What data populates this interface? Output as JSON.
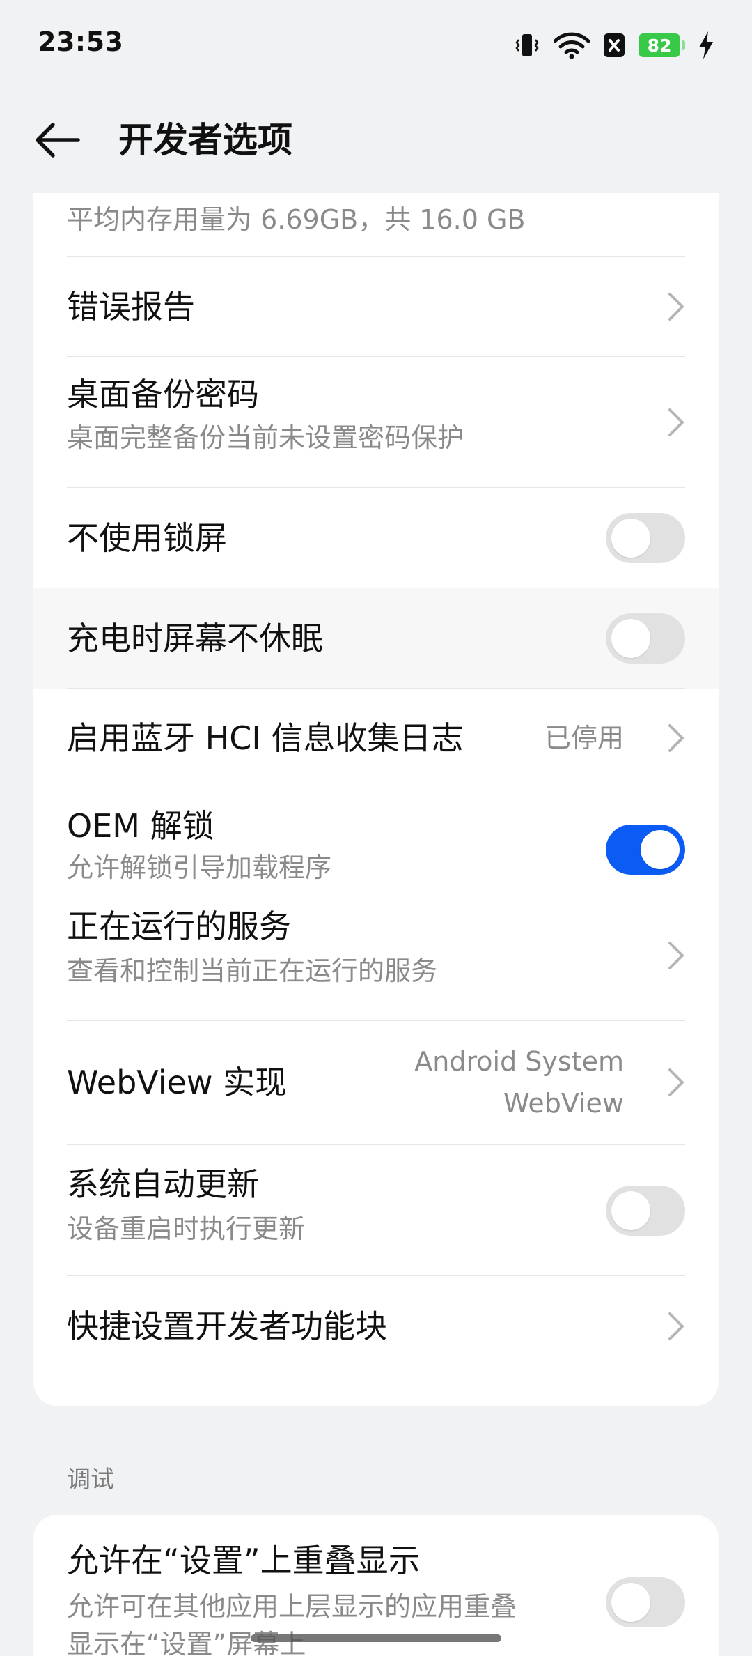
{
  "status_bar": {
    "time": "23:53",
    "battery": "82"
  },
  "app_bar": {
    "title": "开发者选项"
  },
  "settings_card": {
    "memory_row": {
      "subtitle": "平均内存用量为 6.69GB，共 16.0 GB"
    },
    "bug_report": {
      "title": "错误报告"
    },
    "desktop_backup_password": {
      "title": "桌面备份密码",
      "subtitle": "桌面完整备份当前未设置密码保护"
    },
    "no_lock_screen": {
      "title": "不使用锁屏",
      "enabled": false
    },
    "stay_awake": {
      "title": "充电时屏幕不休眠",
      "enabled": false
    },
    "bluetooth_hci_log": {
      "title": "启用蓝牙 HCI 信息收集日志",
      "value": "已停用"
    },
    "oem_unlock": {
      "title": "OEM 解锁",
      "subtitle": "允许解锁引导加载程序",
      "enabled": true
    },
    "running_services": {
      "title": "正在运行的服务",
      "subtitle": "查看和控制当前正在运行的服务"
    },
    "webview_impl": {
      "title": "WebView 实现",
      "value_line1": "Android System",
      "value_line2": "WebView"
    },
    "auto_system_update": {
      "title": "系统自动更新",
      "subtitle": "设备重启时执行更新",
      "enabled": false
    },
    "quick_settings_tiles": {
      "title": "快捷设置开发者功能块"
    }
  },
  "debug_section": {
    "label": "调试",
    "overlay_settings": {
      "title": "允许在“设置”上重叠显示",
      "subtitle_line1": "允许可在其他应用上层显示的应用重叠",
      "subtitle_line2": "显示在“设置”屏幕上",
      "enabled": false
    }
  },
  "colors": {
    "accent": "#0a5cf5",
    "battery": "#38c948",
    "background": "#f1f2f4"
  }
}
